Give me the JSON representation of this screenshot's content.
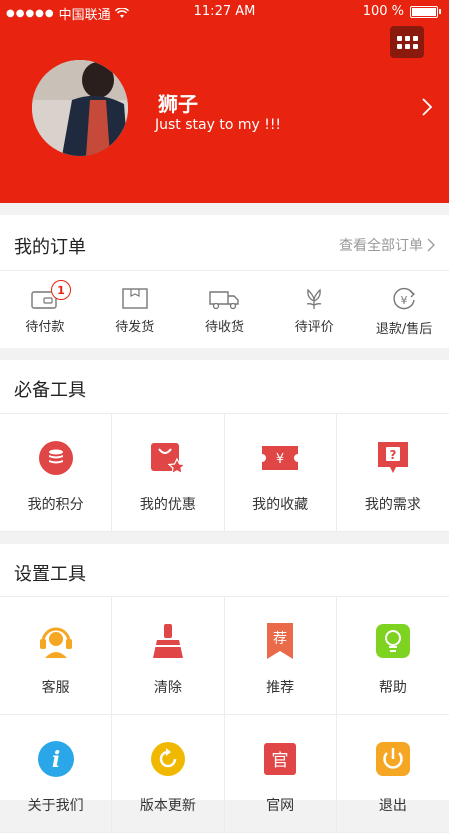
{
  "status_bar": {
    "signal": "●●●●●",
    "carrier": "中国联通",
    "time": "11:27 AM",
    "battery": "100 %"
  },
  "profile": {
    "name": "狮子",
    "signature": "Just  stay to my !!!"
  },
  "orders": {
    "title": "我的订单",
    "view_all": "查看全部订单",
    "items": [
      {
        "label": "待付款",
        "icon": "wallet-icon",
        "badge": "1"
      },
      {
        "label": "待发货",
        "icon": "package-icon"
      },
      {
        "label": "待收货",
        "icon": "truck-icon"
      },
      {
        "label": "待评价",
        "icon": "flower-icon"
      },
      {
        "label": "退款/售后",
        "icon": "refund-icon"
      }
    ]
  },
  "essentials": {
    "title": "必备工具",
    "items": [
      {
        "label": "我的积分",
        "icon": "points-icon"
      },
      {
        "label": "我的优惠",
        "icon": "coupon-bag-icon"
      },
      {
        "label": "我的收藏",
        "icon": "ticket-icon"
      },
      {
        "label": "我的需求",
        "icon": "question-icon",
        "glyph": "?"
      }
    ]
  },
  "settings": {
    "title": "设置工具",
    "items": [
      {
        "label": "客服",
        "icon": "headset-icon"
      },
      {
        "label": "清除",
        "icon": "broom-icon"
      },
      {
        "label": "推荐",
        "icon": "recommend-icon",
        "glyph": "荐"
      },
      {
        "label": "帮助",
        "icon": "lightbulb-icon"
      },
      {
        "label": "关于我们",
        "icon": "info-icon",
        "glyph": "i"
      },
      {
        "label": "版本更新",
        "icon": "update-icon"
      },
      {
        "label": "官网",
        "icon": "website-icon",
        "glyph": "官"
      },
      {
        "label": "退出",
        "icon": "power-icon"
      }
    ]
  },
  "colors": {
    "brand": "#e8230f",
    "dark_red": "#8b1a0e",
    "icon_red": "#e04646",
    "orange": "#f5a623",
    "green": "#7ed321",
    "blue": "#2aa7e8",
    "gold": "#f0b800"
  }
}
